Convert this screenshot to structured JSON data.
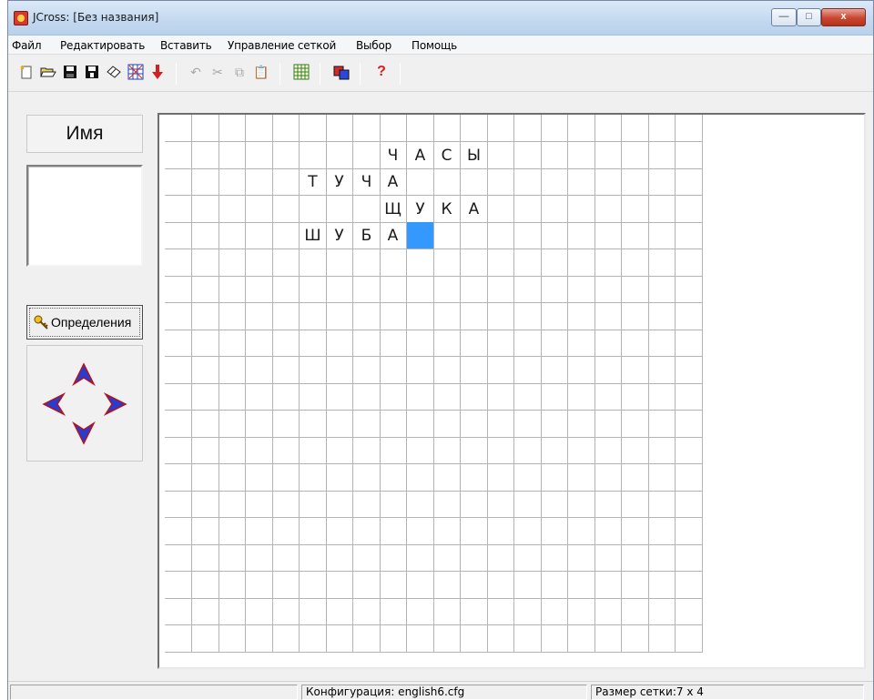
{
  "window": {
    "title": "JCross: [Без названия]",
    "minimize": "—",
    "maximize": "□",
    "close": "x"
  },
  "menu": [
    "Файл",
    "Редактировать",
    "Вставить",
    "Управление сеткой",
    "Выбор",
    "Помощь"
  ],
  "toolbar": {
    "icons": [
      "new-file-icon",
      "open-folder-icon",
      "save-icon",
      "save-as-icon",
      "eraser-icon",
      "generate-grid-icon",
      "export-arrow-icon",
      "undo-icon",
      "cut-icon",
      "copy-icon",
      "paste-icon",
      "grid-icon",
      "colors-icon",
      "help-icon"
    ],
    "help": "?"
  },
  "left_panel": {
    "name_label": "Имя",
    "definitions_label": "Определения",
    "arrows": [
      "up-arrow-icon",
      "left-arrow-icon",
      "right-arrow-icon",
      "down-arrow-icon"
    ]
  },
  "grid": {
    "columns": 20,
    "rows": 20,
    "selected": {
      "row": 4,
      "col": 9
    },
    "letters": [
      {
        "row": 1,
        "col": 8,
        "ch": "Ч"
      },
      {
        "row": 1,
        "col": 9,
        "ch": "А"
      },
      {
        "row": 1,
        "col": 10,
        "ch": "С"
      },
      {
        "row": 1,
        "col": 11,
        "ch": "Ы"
      },
      {
        "row": 2,
        "col": 5,
        "ch": "Т"
      },
      {
        "row": 2,
        "col": 6,
        "ch": "У"
      },
      {
        "row": 2,
        "col": 7,
        "ch": "Ч"
      },
      {
        "row": 2,
        "col": 8,
        "ch": "А"
      },
      {
        "row": 3,
        "col": 8,
        "ch": "Щ"
      },
      {
        "row": 3,
        "col": 9,
        "ch": "У"
      },
      {
        "row": 3,
        "col": 10,
        "ch": "К"
      },
      {
        "row": 3,
        "col": 11,
        "ch": "А"
      },
      {
        "row": 4,
        "col": 5,
        "ch": "Ш"
      },
      {
        "row": 4,
        "col": 6,
        "ch": "У"
      },
      {
        "row": 4,
        "col": 7,
        "ch": "Б"
      },
      {
        "row": 4,
        "col": 8,
        "ch": "А"
      }
    ]
  },
  "status": {
    "config": "Конфигурация: english6.cfg",
    "size": "Размер сетки:7 x 4"
  },
  "colors": {
    "selection": "#3399ff",
    "close_button": "#c9462f"
  }
}
